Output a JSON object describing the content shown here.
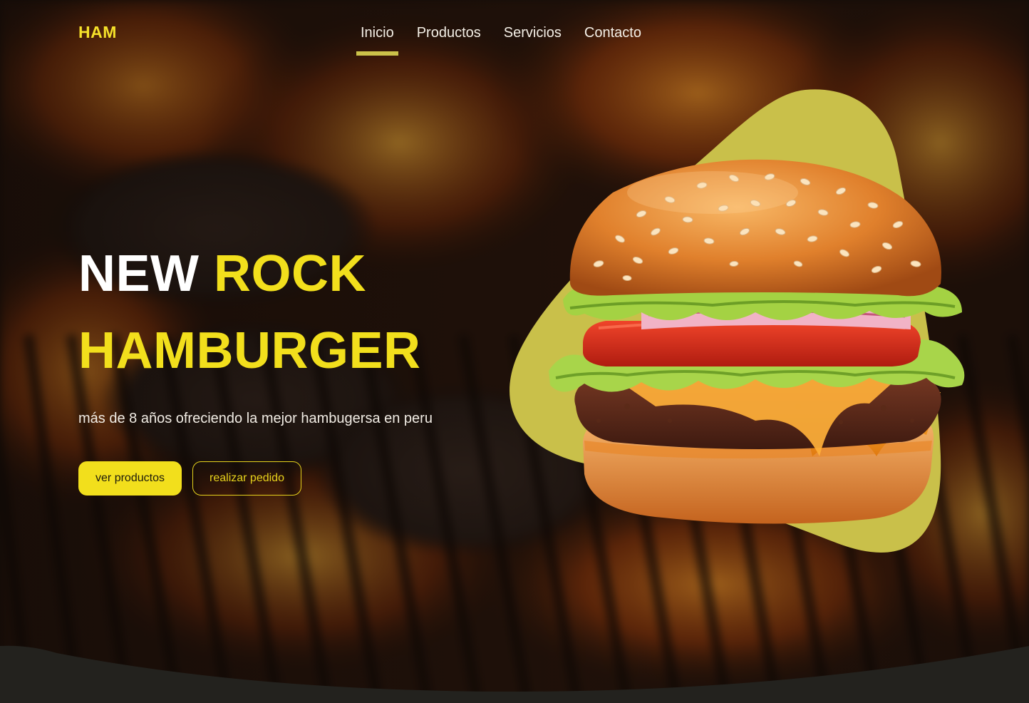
{
  "brand": {
    "logo": "HAM"
  },
  "nav": {
    "items": [
      {
        "label": "Inicio",
        "active": true
      },
      {
        "label": "Productos",
        "active": false
      },
      {
        "label": "Servicios",
        "active": false
      },
      {
        "label": "Contacto",
        "active": false
      }
    ]
  },
  "hero": {
    "title_word1": "NEW",
    "title_word2": "ROCK",
    "title_line2": "HAMBURGER",
    "subtitle": "más de 8 años ofreciendo la mejor hambugersa en peru",
    "primary_button": "ver productos",
    "secondary_button": "realizar pedido"
  },
  "colors": {
    "accent_yellow": "#f2df1c",
    "blob_olive": "#c9c04a",
    "footer_dark": "#23221e"
  },
  "icons": {
    "hero_image": "burger-image"
  }
}
